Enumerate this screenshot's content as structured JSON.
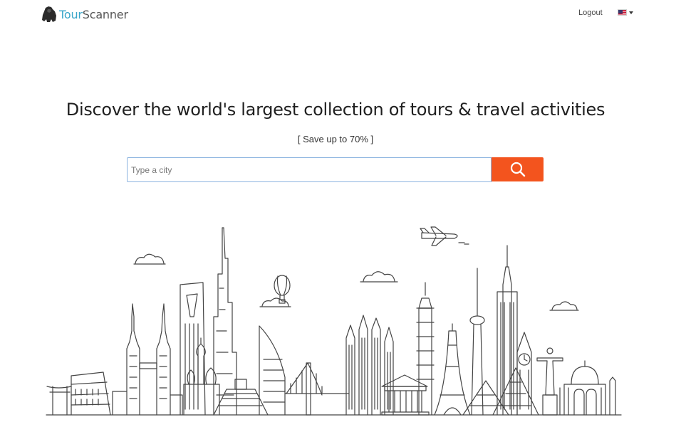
{
  "header": {
    "logo": {
      "part1": "Tour",
      "part2": "Scanner"
    },
    "logout_label": "Logout",
    "language": {
      "icon": "us-flag-icon"
    }
  },
  "hero": {
    "headline": "Discover the world's largest collection of tours & travel activities",
    "subheadline": "[ Save up to 70% ]"
  },
  "search": {
    "placeholder": "Type a city",
    "value": "",
    "button_icon": "search-icon"
  },
  "colors": {
    "accent": "#f3541e",
    "brand_blue": "#3aa6c9",
    "input_border": "#8cb4e0"
  },
  "illustration": {
    "icon": "world-skyline-illustration"
  }
}
